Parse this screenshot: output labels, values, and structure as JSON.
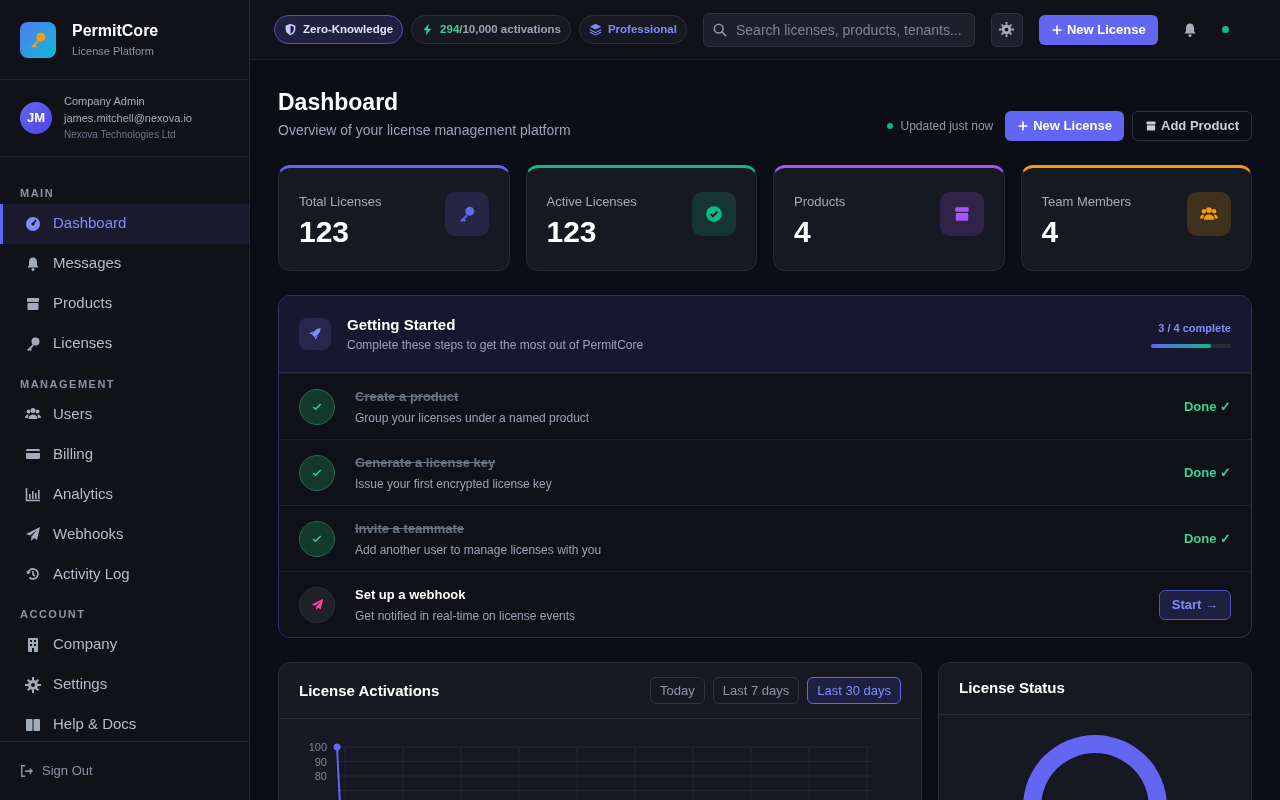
{
  "brand": {
    "name": "PermitCore",
    "subtitle": "License Platform"
  },
  "user": {
    "initials": "JM",
    "role": "Company Admin",
    "email": "james.mitchell@nexova.io",
    "company": "Nexova Technologies Ltd"
  },
  "sidebar": {
    "sections": [
      {
        "title": "MAIN",
        "items": [
          {
            "label": "Dashboard",
            "selected": true
          },
          {
            "label": "Messages",
            "selected": false
          },
          {
            "label": "Products",
            "selected": false
          },
          {
            "label": "Licenses",
            "selected": false
          }
        ]
      },
      {
        "title": "MANAGEMENT",
        "items": [
          {
            "label": "Users",
            "selected": false
          },
          {
            "label": "Billing",
            "selected": false
          },
          {
            "label": "Analytics",
            "selected": false
          },
          {
            "label": "Webhooks",
            "selected": false
          },
          {
            "label": "Activity Log",
            "selected": false
          }
        ]
      },
      {
        "title": "ACCOUNT",
        "items": [
          {
            "label": "Company",
            "selected": false
          },
          {
            "label": "Settings",
            "selected": false
          },
          {
            "label": "Help & Docs",
            "selected": false
          }
        ]
      }
    ],
    "sign_out": "Sign Out"
  },
  "topbar": {
    "badges": [
      {
        "kind": "security",
        "label": "Zero-Knowledge"
      },
      {
        "kind": "usage",
        "used": "294",
        "total": "/10,000",
        "label": "activations"
      },
      {
        "kind": "plan",
        "label": "Professional"
      }
    ],
    "search": {
      "placeholder": "Search licenses, products, tenants..."
    },
    "new_button": "New License"
  },
  "header": {
    "title": "Dashboard",
    "subtitle": "Overview of your license management platform",
    "updated": "Updated just now",
    "buttons": [
      {
        "kind": "primary",
        "label": "New License"
      },
      {
        "kind": "outline",
        "label": "Add Product"
      }
    ]
  },
  "stats": [
    {
      "label": "Total Licenses",
      "value": "123",
      "color": "#6366f1"
    },
    {
      "label": "Active Licenses",
      "value": "123",
      "color": "#10b981"
    },
    {
      "label": "Products",
      "value": "4",
      "color": "#a855f7"
    },
    {
      "label": "Team Members",
      "value": "4",
      "color": "#f59e0b"
    }
  ],
  "getting_started": {
    "title": "Getting Started",
    "subtitle": "Complete these steps to get the most out of PermitCore",
    "progress_text": "3 / 4 complete",
    "level": 0.75,
    "steps": [
      {
        "title": "Create a product",
        "description": "Group your licenses under a named product",
        "done": true,
        "action": "Done ✓"
      },
      {
        "title": "Generate a license key",
        "description": "Issue your first encrypted license key",
        "done": true,
        "action": "Done ✓"
      },
      {
        "title": "Invite a teammate",
        "description": "Add another user to manage licenses with you",
        "done": true,
        "action": "Done ✓"
      },
      {
        "title": "Set up a webhook",
        "description": "Get notified in real-time on license events",
        "done": false,
        "action": "Start →"
      }
    ]
  },
  "activations": {
    "title": "License Activations",
    "ranges": [
      {
        "label": "Today",
        "selected": false
      },
      {
        "label": "Last 7 days",
        "selected": false
      },
      {
        "label": "Last 30 days",
        "selected": true
      }
    ],
    "y_axis_labels": [
      "100",
      "90",
      "80"
    ]
  },
  "status": {
    "title": "License Status"
  }
}
